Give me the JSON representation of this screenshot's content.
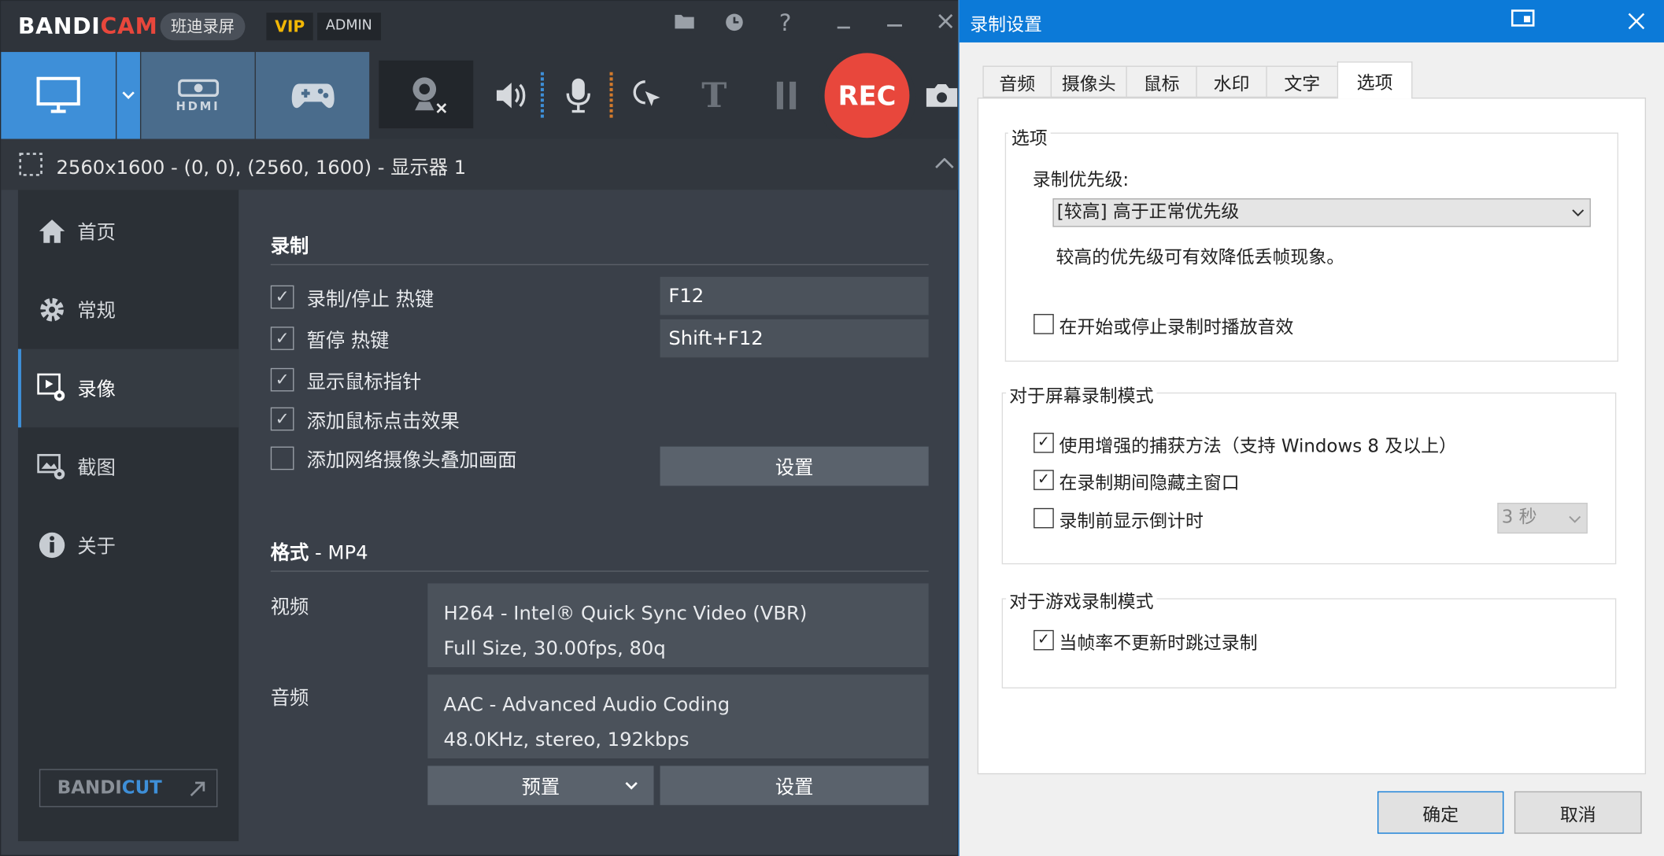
{
  "app": {
    "logo_a": "BANDI",
    "logo_b": "CAM",
    "brand_cn": "班迪录屏",
    "vip": "VIP",
    "admin": "ADMIN"
  },
  "toolbar": {
    "hdmi": "HDMI",
    "rec": "REC",
    "text_tool": "T"
  },
  "resolution": "2560x1600 - (0, 0), (2560, 1600) - 显示器 1",
  "sidebar": {
    "items": [
      {
        "label": "首页",
        "icon": "home-icon"
      },
      {
        "label": "常规",
        "icon": "gear-icon"
      },
      {
        "label": "录像",
        "icon": "video-settings-icon"
      },
      {
        "label": "截图",
        "icon": "screenshot-settings-icon"
      },
      {
        "label": "关于",
        "icon": "info-icon"
      }
    ],
    "bandicut": {
      "a": "BANDI",
      "b": "CUT"
    }
  },
  "main": {
    "record_title": "录制",
    "hotkey_rec_label": "录制/停止 热键",
    "hotkey_rec_value": "F12",
    "hotkey_pause_label": "暂停 热键",
    "hotkey_pause_value": "Shift+F12",
    "show_cursor": "显示鼠标指针",
    "click_effect": "添加鼠标点击效果",
    "webcam_overlay": "添加网络摄像头叠加画面",
    "settings_btn": "设置",
    "format_title": "格式",
    "format_value": "- MP4",
    "video_label": "视频",
    "video_line1": "H264 - Intel® Quick Sync Video (VBR)",
    "video_line2": "Full Size, 30.00fps, 80q",
    "audio_label": "音频",
    "audio_line1": "AAC - Advanced Audio Coding",
    "audio_line2": "48.0KHz, stereo, 192kbps",
    "preset_btn": "预置",
    "settings_btn2": "设置"
  },
  "dialog": {
    "title": "录制设置",
    "tabs": [
      "音频",
      "摄像头",
      "鼠标",
      "水印",
      "文字",
      "选项"
    ],
    "group_options": "选项",
    "priority_label": "录制优先级:",
    "priority_value": "[较高] 高于正常优先级",
    "priority_hint": "较高的优先级可有效降低丢帧现象。",
    "play_sound": "在开始或停止录制时播放音效",
    "group_screen": "对于屏幕录制模式",
    "enhanced_capture": "使用增强的捕获方法（支持 Windows 8 及以上）",
    "hide_window": "在录制期间隐藏主窗口",
    "countdown": "录制前显示倒计时",
    "countdown_value": "3 秒",
    "group_game": "对于游戏录制模式",
    "skip_frames": "当帧率不更新时跳过录制",
    "ok": "确定",
    "cancel": "取消"
  },
  "colors": {
    "accent_blue": "#3e8fd8",
    "rec_red": "#e8473c",
    "vip_gold": "#f2b705",
    "dialog_title": "#0c7ad8"
  }
}
